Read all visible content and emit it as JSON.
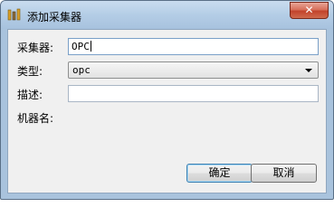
{
  "window": {
    "title": "添加采集器",
    "close_glyph": "✕"
  },
  "form": {
    "collector_label": "采集器:",
    "collector_value": "OPC",
    "type_label": "类型:",
    "type_value": "opc",
    "description_label": "描述:",
    "description_value": "",
    "machine_label": "机器名:"
  },
  "buttons": {
    "ok": "确定",
    "cancel": "取消"
  }
}
